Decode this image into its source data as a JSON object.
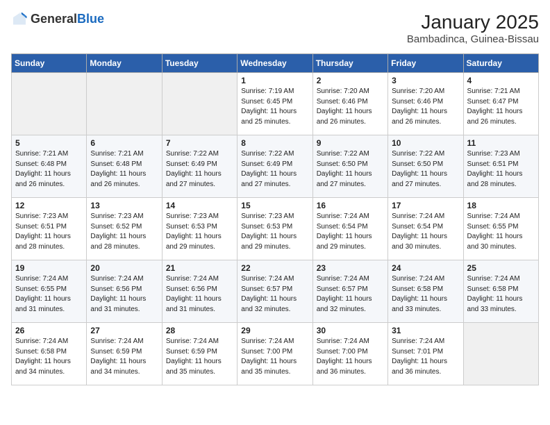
{
  "header": {
    "logo": {
      "general": "General",
      "blue": "Blue"
    },
    "title": "January 2025",
    "location": "Bambadinca, Guinea-Bissau"
  },
  "weekdays": [
    "Sunday",
    "Monday",
    "Tuesday",
    "Wednesday",
    "Thursday",
    "Friday",
    "Saturday"
  ],
  "weeks": [
    [
      {
        "day": "",
        "info": ""
      },
      {
        "day": "",
        "info": ""
      },
      {
        "day": "",
        "info": ""
      },
      {
        "day": "1",
        "info": "Sunrise: 7:19 AM\nSunset: 6:45 PM\nDaylight: 11 hours and 25 minutes."
      },
      {
        "day": "2",
        "info": "Sunrise: 7:20 AM\nSunset: 6:46 PM\nDaylight: 11 hours and 26 minutes."
      },
      {
        "day": "3",
        "info": "Sunrise: 7:20 AM\nSunset: 6:46 PM\nDaylight: 11 hours and 26 minutes."
      },
      {
        "day": "4",
        "info": "Sunrise: 7:21 AM\nSunset: 6:47 PM\nDaylight: 11 hours and 26 minutes."
      }
    ],
    [
      {
        "day": "5",
        "info": "Sunrise: 7:21 AM\nSunset: 6:48 PM\nDaylight: 11 hours and 26 minutes."
      },
      {
        "day": "6",
        "info": "Sunrise: 7:21 AM\nSunset: 6:48 PM\nDaylight: 11 hours and 26 minutes."
      },
      {
        "day": "7",
        "info": "Sunrise: 7:22 AM\nSunset: 6:49 PM\nDaylight: 11 hours and 27 minutes."
      },
      {
        "day": "8",
        "info": "Sunrise: 7:22 AM\nSunset: 6:49 PM\nDaylight: 11 hours and 27 minutes."
      },
      {
        "day": "9",
        "info": "Sunrise: 7:22 AM\nSunset: 6:50 PM\nDaylight: 11 hours and 27 minutes."
      },
      {
        "day": "10",
        "info": "Sunrise: 7:22 AM\nSunset: 6:50 PM\nDaylight: 11 hours and 27 minutes."
      },
      {
        "day": "11",
        "info": "Sunrise: 7:23 AM\nSunset: 6:51 PM\nDaylight: 11 hours and 28 minutes."
      }
    ],
    [
      {
        "day": "12",
        "info": "Sunrise: 7:23 AM\nSunset: 6:51 PM\nDaylight: 11 hours and 28 minutes."
      },
      {
        "day": "13",
        "info": "Sunrise: 7:23 AM\nSunset: 6:52 PM\nDaylight: 11 hours and 28 minutes."
      },
      {
        "day": "14",
        "info": "Sunrise: 7:23 AM\nSunset: 6:53 PM\nDaylight: 11 hours and 29 minutes."
      },
      {
        "day": "15",
        "info": "Sunrise: 7:23 AM\nSunset: 6:53 PM\nDaylight: 11 hours and 29 minutes."
      },
      {
        "day": "16",
        "info": "Sunrise: 7:24 AM\nSunset: 6:54 PM\nDaylight: 11 hours and 29 minutes."
      },
      {
        "day": "17",
        "info": "Sunrise: 7:24 AM\nSunset: 6:54 PM\nDaylight: 11 hours and 30 minutes."
      },
      {
        "day": "18",
        "info": "Sunrise: 7:24 AM\nSunset: 6:55 PM\nDaylight: 11 hours and 30 minutes."
      }
    ],
    [
      {
        "day": "19",
        "info": "Sunrise: 7:24 AM\nSunset: 6:55 PM\nDaylight: 11 hours and 31 minutes."
      },
      {
        "day": "20",
        "info": "Sunrise: 7:24 AM\nSunset: 6:56 PM\nDaylight: 11 hours and 31 minutes."
      },
      {
        "day": "21",
        "info": "Sunrise: 7:24 AM\nSunset: 6:56 PM\nDaylight: 11 hours and 31 minutes."
      },
      {
        "day": "22",
        "info": "Sunrise: 7:24 AM\nSunset: 6:57 PM\nDaylight: 11 hours and 32 minutes."
      },
      {
        "day": "23",
        "info": "Sunrise: 7:24 AM\nSunset: 6:57 PM\nDaylight: 11 hours and 32 minutes."
      },
      {
        "day": "24",
        "info": "Sunrise: 7:24 AM\nSunset: 6:58 PM\nDaylight: 11 hours and 33 minutes."
      },
      {
        "day": "25",
        "info": "Sunrise: 7:24 AM\nSunset: 6:58 PM\nDaylight: 11 hours and 33 minutes."
      }
    ],
    [
      {
        "day": "26",
        "info": "Sunrise: 7:24 AM\nSunset: 6:58 PM\nDaylight: 11 hours and 34 minutes."
      },
      {
        "day": "27",
        "info": "Sunrise: 7:24 AM\nSunset: 6:59 PM\nDaylight: 11 hours and 34 minutes."
      },
      {
        "day": "28",
        "info": "Sunrise: 7:24 AM\nSunset: 6:59 PM\nDaylight: 11 hours and 35 minutes."
      },
      {
        "day": "29",
        "info": "Sunrise: 7:24 AM\nSunset: 7:00 PM\nDaylight: 11 hours and 35 minutes."
      },
      {
        "day": "30",
        "info": "Sunrise: 7:24 AM\nSunset: 7:00 PM\nDaylight: 11 hours and 36 minutes."
      },
      {
        "day": "31",
        "info": "Sunrise: 7:24 AM\nSunset: 7:01 PM\nDaylight: 11 hours and 36 minutes."
      },
      {
        "day": "",
        "info": ""
      }
    ]
  ]
}
